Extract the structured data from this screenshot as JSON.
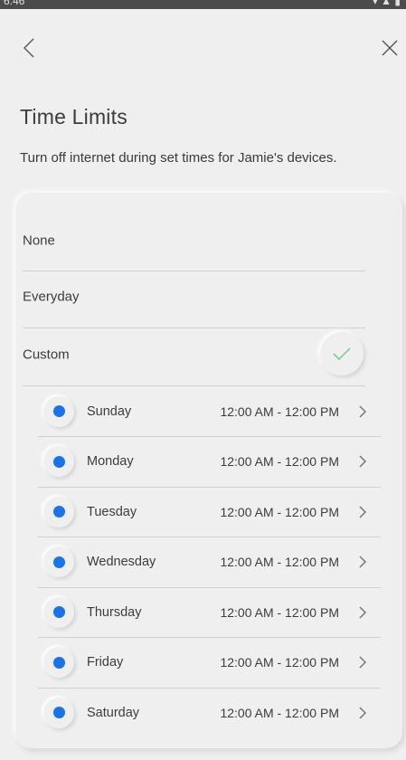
{
  "status_bar": {
    "time": "6:46",
    "icons": "▾ ▲ ▮"
  },
  "nav": {
    "back_icon": "chevron-left-icon",
    "close_icon": "close-icon"
  },
  "header": {
    "title": "Time Limits",
    "subtitle": "Turn off internet during set times for Jamie's devices."
  },
  "options": [
    {
      "label": "None",
      "selected": false
    },
    {
      "label": "Everyday",
      "selected": false
    },
    {
      "label": "Custom",
      "selected": true
    }
  ],
  "days": [
    {
      "name": "Sunday",
      "time": "12:00 AM - 12:00 PM",
      "enabled": true
    },
    {
      "name": "Monday",
      "time": "12:00 AM - 12:00 PM",
      "enabled": true
    },
    {
      "name": "Tuesday",
      "time": "12:00 AM - 12:00 PM",
      "enabled": true
    },
    {
      "name": "Wednesday",
      "time": "12:00 AM - 12:00 PM",
      "enabled": true
    },
    {
      "name": "Thursday",
      "time": "12:00 AM - 12:00 PM",
      "enabled": true
    },
    {
      "name": "Friday",
      "time": "12:00 AM - 12:00 PM",
      "enabled": true
    },
    {
      "name": "Saturday",
      "time": "12:00 AM - 12:00 PM",
      "enabled": true
    }
  ],
  "colors": {
    "accent": "#1a73e8",
    "check": "#7ccf8b",
    "background": "#efefef",
    "divider": "#d0d0d0"
  }
}
